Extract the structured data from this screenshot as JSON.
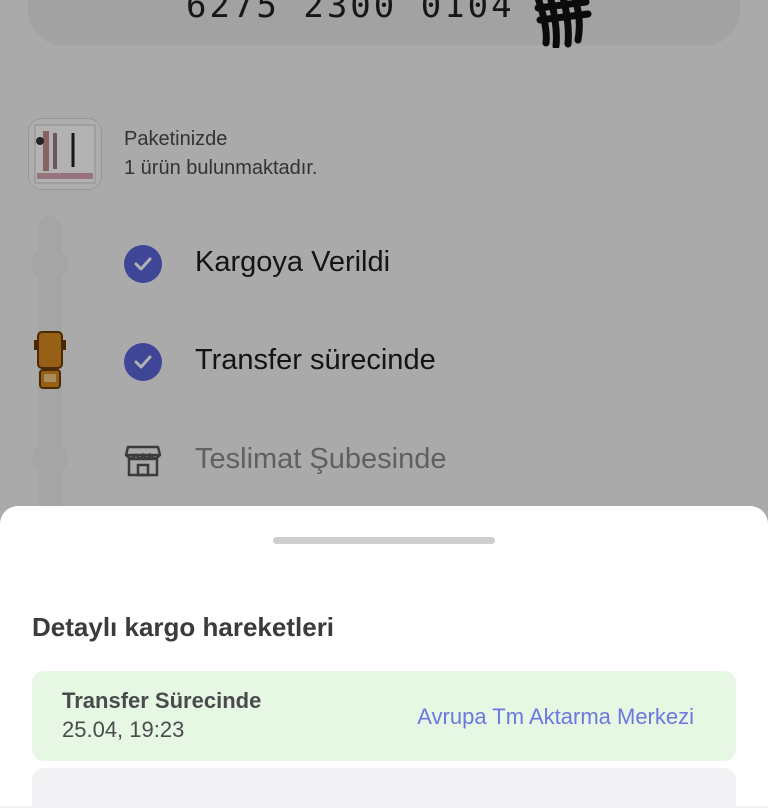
{
  "top_card": {
    "number": "6275 2300 0104"
  },
  "package": {
    "line1": "Paketinizde",
    "line2": "1 ürün bulunmaktadır."
  },
  "steps": [
    {
      "label": "Kargoya Verildi",
      "done": true
    },
    {
      "label": "Transfer sürecinde",
      "done": true
    },
    {
      "label": "Teslimat Şubesinde",
      "done": false
    }
  ],
  "sheet": {
    "title": "Detaylı kargo hareketleri",
    "movements": [
      {
        "status": "Transfer Sürecinde",
        "date": "25.04, 19:23",
        "location": "Avrupa Tm Aktarma Merkezi"
      }
    ]
  },
  "colors": {
    "accent": "#5b63d9",
    "link": "#6c78e0",
    "movement_bg": "#e6f8e4",
    "truck": "#d98a22"
  },
  "icons": [
    "check-icon",
    "store-icon",
    "truck-icon"
  ]
}
